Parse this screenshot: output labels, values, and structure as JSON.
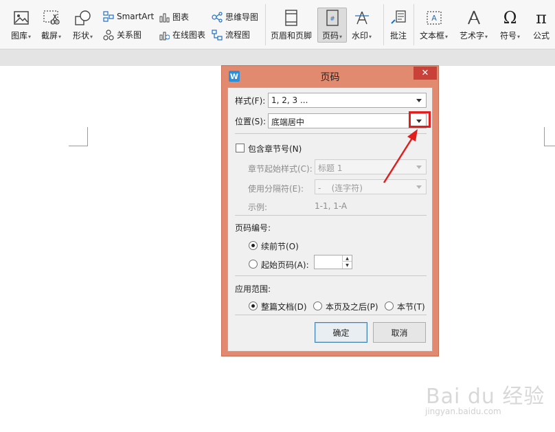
{
  "ribbon": {
    "gallery": "图库",
    "screenshot": "截屏",
    "shapes": "形状",
    "smartart": "SmartArt",
    "chart": "图表",
    "mindmap": "思维导图",
    "relation": "关系图",
    "online_chart": "在线图表",
    "flowchart": "流程图",
    "header_footer": "页眉和页脚",
    "page_number": "页码",
    "watermark": "水印",
    "comment": "批注",
    "textbox": "文本框",
    "wordart": "艺术字",
    "symbol": "符号",
    "formula": "公式",
    "dropdown_mark": "▾",
    "accent_color": "#1f6fc4"
  },
  "dialog": {
    "title": "页码",
    "close_symbol": "✕",
    "logo_text": "W",
    "style_label": "样式(F):",
    "style_value": "1, 2, 3 ...",
    "position_label": "位置(S):",
    "position_value": "底端居中",
    "include_chapter_label": "包含章节号(N)",
    "chapter_start_label": "章节起始样式(C):",
    "chapter_start_value": "标题 1",
    "separator_label": "使用分隔符(E):",
    "separator_value": "-    (连字符)",
    "example_label": "示例:",
    "example_value": "1-1, 1-A",
    "numbering_group": "页码编号:",
    "continue_label": "续前节(O)",
    "start_at_label": "起始页码(A):",
    "start_at_value": "",
    "spin_up": "▲",
    "spin_down": "▼",
    "scope_group": "应用范围:",
    "scope_whole": "整篇文档(D)",
    "scope_after": "本页及之后(P)",
    "scope_section": "本节(T)",
    "ok_label": "确定",
    "cancel_label": "取消",
    "frame_color": "#e28a70",
    "highlight_color": "#e01e1e"
  },
  "watermark": {
    "brand": "Bai du 经验",
    "url": "jingyan.baidu.com"
  }
}
